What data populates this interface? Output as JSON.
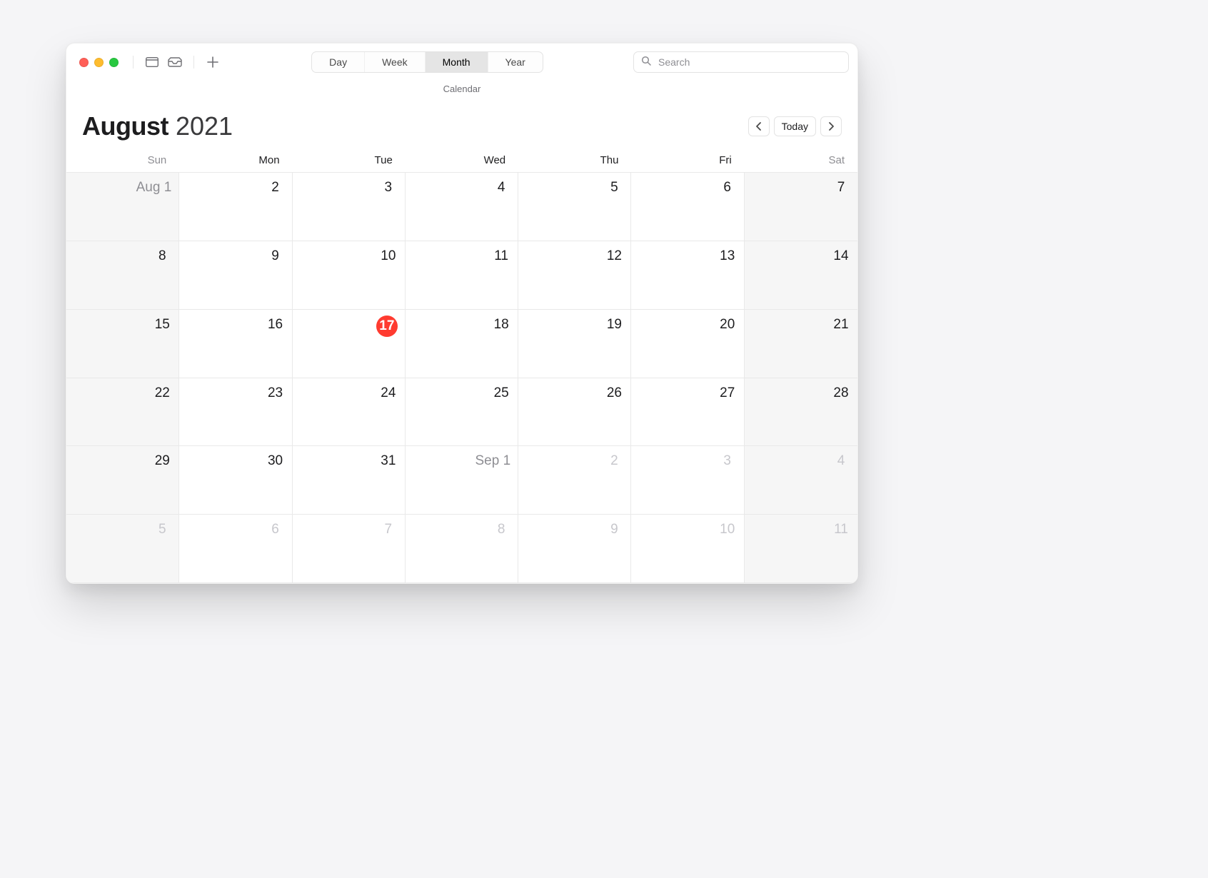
{
  "app_subtitle": "Calendar",
  "toolbar": {
    "views": [
      "Day",
      "Week",
      "Month",
      "Year"
    ],
    "active_view_index": 2,
    "search_placeholder": "Search"
  },
  "header": {
    "month": "August",
    "year": "2021",
    "today_label": "Today"
  },
  "weekdays": [
    {
      "label": "Sun",
      "weekend": true
    },
    {
      "label": "Mon",
      "weekend": false
    },
    {
      "label": "Tue",
      "weekend": false
    },
    {
      "label": "Wed",
      "weekend": false
    },
    {
      "label": "Thu",
      "weekend": false
    },
    {
      "label": "Fri",
      "weekend": false
    },
    {
      "label": "Sat",
      "weekend": true
    }
  ],
  "today_index": 16,
  "cells": [
    {
      "label": "Aug 1",
      "outside": false,
      "weekend": true,
      "first": true
    },
    {
      "label": "2",
      "outside": false,
      "weekend": false
    },
    {
      "label": "3",
      "outside": false,
      "weekend": false
    },
    {
      "label": "4",
      "outside": false,
      "weekend": false
    },
    {
      "label": "5",
      "outside": false,
      "weekend": false
    },
    {
      "label": "6",
      "outside": false,
      "weekend": false
    },
    {
      "label": "7",
      "outside": false,
      "weekend": true
    },
    {
      "label": "8",
      "outside": false,
      "weekend": true
    },
    {
      "label": "9",
      "outside": false,
      "weekend": false
    },
    {
      "label": "10",
      "outside": false,
      "weekend": false
    },
    {
      "label": "11",
      "outside": false,
      "weekend": false
    },
    {
      "label": "12",
      "outside": false,
      "weekend": false
    },
    {
      "label": "13",
      "outside": false,
      "weekend": false
    },
    {
      "label": "14",
      "outside": false,
      "weekend": true
    },
    {
      "label": "15",
      "outside": false,
      "weekend": true
    },
    {
      "label": "16",
      "outside": false,
      "weekend": false
    },
    {
      "label": "17",
      "outside": false,
      "weekend": false
    },
    {
      "label": "18",
      "outside": false,
      "weekend": false
    },
    {
      "label": "19",
      "outside": false,
      "weekend": false
    },
    {
      "label": "20",
      "outside": false,
      "weekend": false
    },
    {
      "label": "21",
      "outside": false,
      "weekend": true
    },
    {
      "label": "22",
      "outside": false,
      "weekend": true
    },
    {
      "label": "23",
      "outside": false,
      "weekend": false
    },
    {
      "label": "24",
      "outside": false,
      "weekend": false
    },
    {
      "label": "25",
      "outside": false,
      "weekend": false
    },
    {
      "label": "26",
      "outside": false,
      "weekend": false
    },
    {
      "label": "27",
      "outside": false,
      "weekend": false
    },
    {
      "label": "28",
      "outside": false,
      "weekend": true
    },
    {
      "label": "29",
      "outside": false,
      "weekend": true
    },
    {
      "label": "30",
      "outside": false,
      "weekend": false
    },
    {
      "label": "31",
      "outside": false,
      "weekend": false
    },
    {
      "label": "Sep 1",
      "outside": true,
      "weekend": false,
      "first": true
    },
    {
      "label": "2",
      "outside": true,
      "weekend": false
    },
    {
      "label": "3",
      "outside": true,
      "weekend": false
    },
    {
      "label": "4",
      "outside": true,
      "weekend": true
    },
    {
      "label": "5",
      "outside": true,
      "weekend": true
    },
    {
      "label": "6",
      "outside": true,
      "weekend": false
    },
    {
      "label": "7",
      "outside": true,
      "weekend": false
    },
    {
      "label": "8",
      "outside": true,
      "weekend": false
    },
    {
      "label": "9",
      "outside": true,
      "weekend": false
    },
    {
      "label": "10",
      "outside": true,
      "weekend": false
    },
    {
      "label": "11",
      "outside": true,
      "weekend": true
    }
  ]
}
